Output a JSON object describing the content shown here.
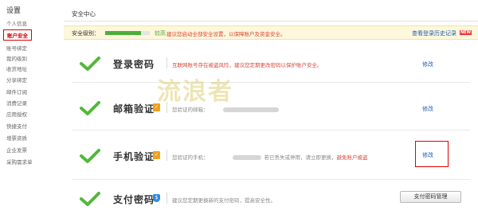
{
  "sidebar": {
    "title": "设置",
    "items": [
      {
        "label": "个人信息",
        "active": false
      },
      {
        "label": "账户安全",
        "active": true
      },
      {
        "label": "账号绑定",
        "active": false
      },
      {
        "label": "我的级别",
        "active": false
      },
      {
        "label": "收货地址",
        "active": false
      },
      {
        "label": "分享绑定",
        "active": false
      },
      {
        "label": "邮件订阅",
        "active": false
      },
      {
        "label": "消费记录",
        "active": false
      },
      {
        "label": "应用授权",
        "active": false
      },
      {
        "label": "快捷支付",
        "active": false
      },
      {
        "label": "增票资质",
        "active": false
      },
      {
        "label": "企业发票",
        "active": false
      },
      {
        "label": "采购需求单",
        "active": false
      }
    ]
  },
  "main": {
    "title": "安全中心",
    "alert": {
      "level_label": "安全级别：",
      "level_fraction": 0.8,
      "level_text": "较高",
      "tip": "建议您启动全部安全设置，以保障账户及资金安全。",
      "history_link": "查看登录历史记录",
      "new_badge": "NEW"
    },
    "rows": [
      {
        "title": "登录密码",
        "desc": "互联网账号存在被盗风险，建议您定期更改密码以保护账户安全。",
        "action": "修改"
      },
      {
        "title": "邮箱验证",
        "desc": "您验证的邮箱：",
        "action": "修改"
      },
      {
        "title": "手机验证",
        "desc_a": "您验证的手机：",
        "desc_b": "若已丢失或停用，请立即更换，",
        "desc_c": "避免账户被盗",
        "action": "修改"
      },
      {
        "title": "支付密码",
        "desc": "建议您定期更换新的支付密码，提高安全性。",
        "action": "支付密码管理"
      }
    ],
    "watermark": "流浪者",
    "colors": {
      "check": "#52b83a",
      "alert_bg": "#fdf7dc",
      "highlight": "#dd0000",
      "link": "#1d5fb4"
    }
  }
}
